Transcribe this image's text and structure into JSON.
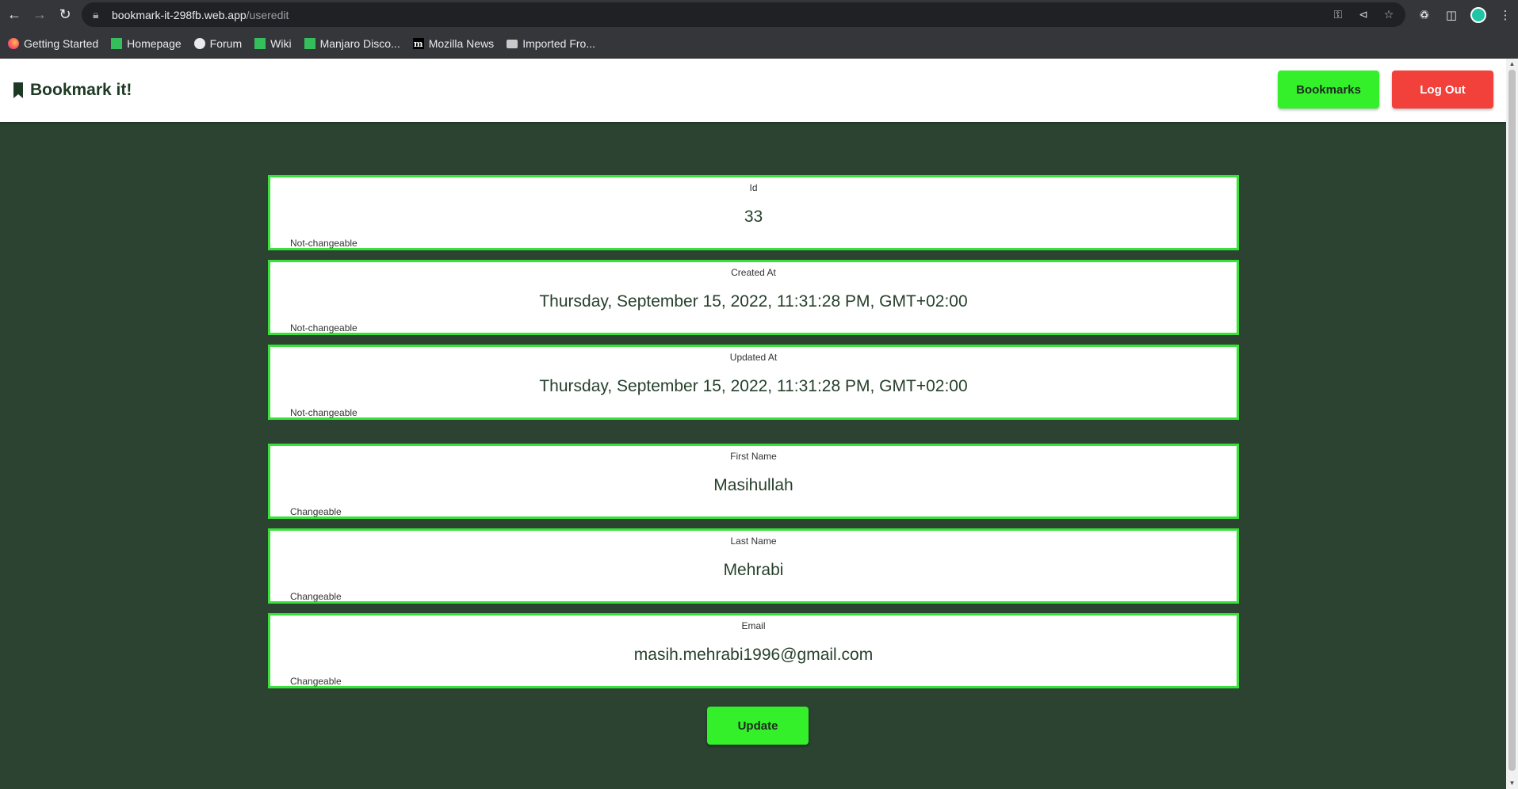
{
  "browser": {
    "url_host": "bookmark-it-298fb.web.app",
    "url_path": "/useredit",
    "bookmarks": [
      {
        "label": "Getting Started",
        "icon": "firefox-icon"
      },
      {
        "label": "Homepage",
        "icon": "manjaro-icon"
      },
      {
        "label": "Forum",
        "icon": "globe-icon"
      },
      {
        "label": "Wiki",
        "icon": "manjaro-icon"
      },
      {
        "label": "Manjaro Disco...",
        "icon": "manjaro-icon"
      },
      {
        "label": "Mozilla News",
        "icon": "mozilla-icon"
      },
      {
        "label": "Imported Fro...",
        "icon": "folder-icon"
      }
    ]
  },
  "header": {
    "brand": "Bookmark it!",
    "bookmarks_button": "Bookmarks",
    "logout_button": "Log Out"
  },
  "fields": [
    {
      "label": "Id",
      "value": "33",
      "note": "Not-changeable"
    },
    {
      "label": "Created At",
      "value": "Thursday, September 15, 2022, 11:31:28 PM, GMT+02:00",
      "note": "Not-changeable"
    },
    {
      "label": "Updated At",
      "value": "Thursday, September 15, 2022, 11:31:28 PM, GMT+02:00",
      "note": "Not-changeable"
    },
    {
      "label": "First Name",
      "value": "Masihullah",
      "note": "Changeable"
    },
    {
      "label": "Last Name",
      "value": "Mehrabi",
      "note": "Changeable"
    },
    {
      "label": "Email",
      "value": "masih.mehrabi1996@gmail.com",
      "note": "Changeable"
    }
  ],
  "update_button": "Update",
  "colors": {
    "background": "#2b4330",
    "accent_green": "#33f02b",
    "field_border": "#38e238",
    "logout_red": "#f2403b"
  }
}
